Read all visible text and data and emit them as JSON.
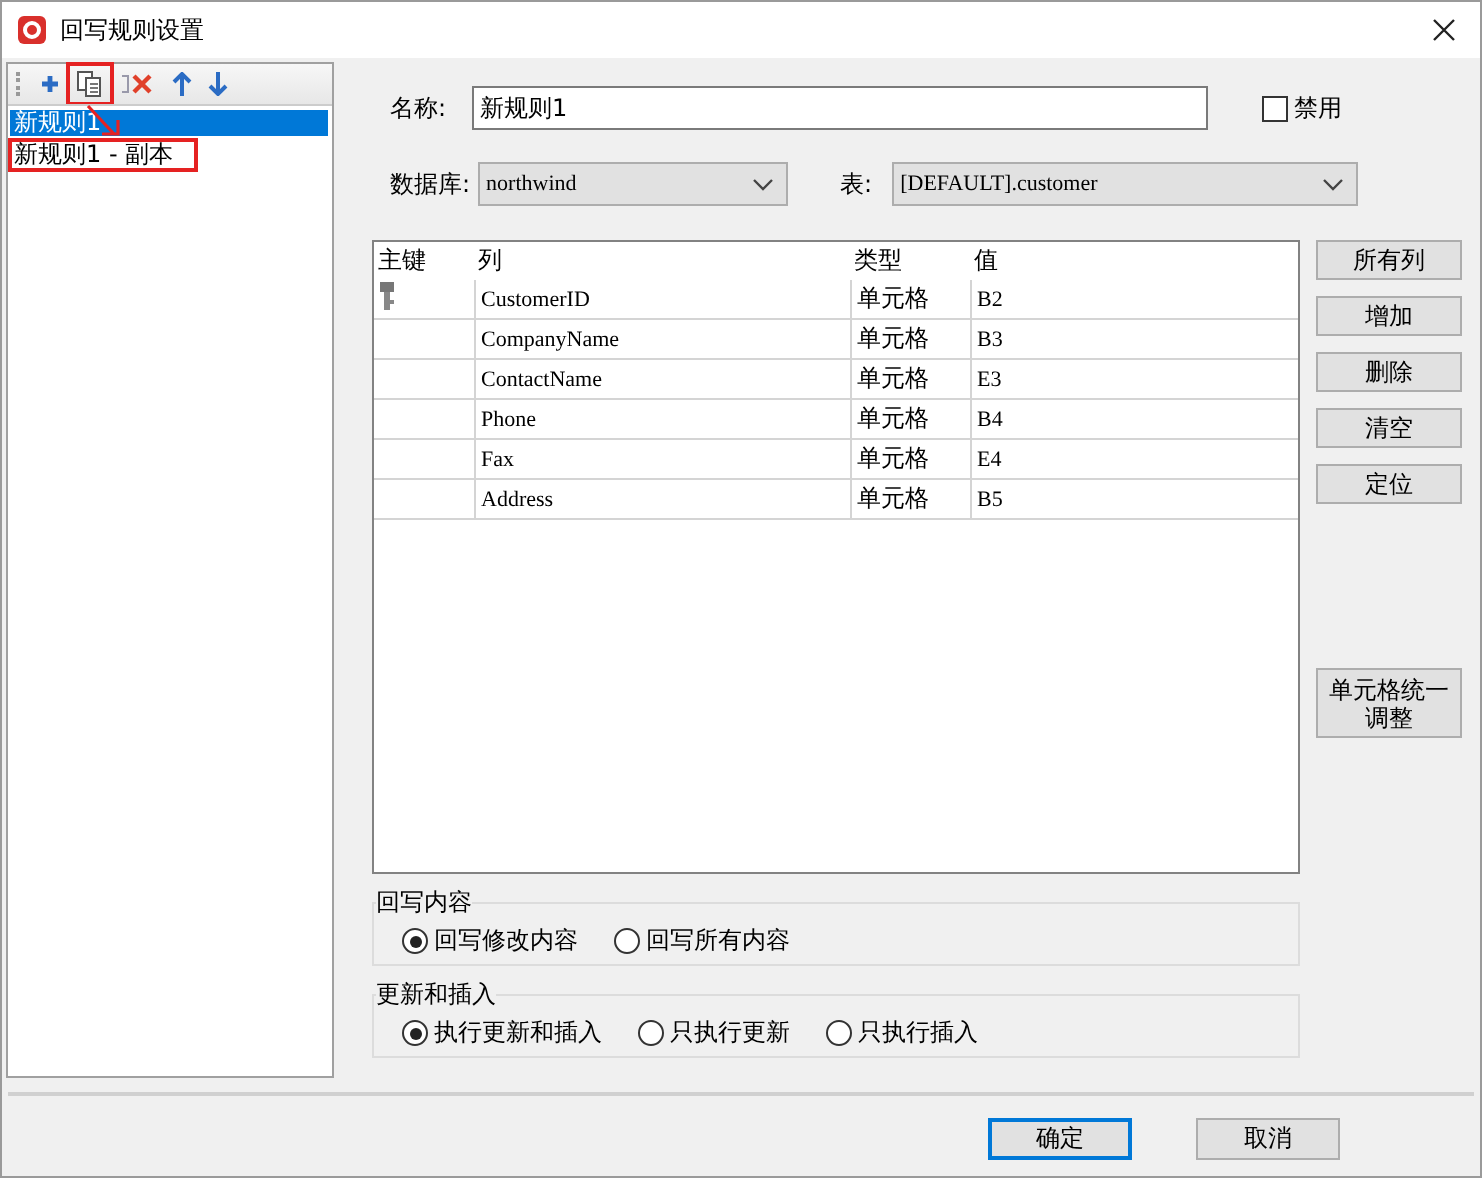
{
  "window": {
    "title": "回写规则设置"
  },
  "toolbar": [
    {
      "kind": "add",
      "annotated": false
    },
    {
      "kind": "copy",
      "annotated": true
    },
    {
      "kind": "delete",
      "annotated": false
    },
    {
      "kind": "up",
      "annotated": false
    },
    {
      "kind": "down",
      "annotated": false
    }
  ],
  "rules": [
    {
      "label": "新规则1",
      "selected": true,
      "annotated": false
    },
    {
      "label": "新规则1 - 副本",
      "selected": false,
      "annotated": true
    }
  ],
  "annotation_arrow": true,
  "name": {
    "label": "名称:",
    "value": "新规则1"
  },
  "disable": {
    "label": "禁用",
    "checked": false
  },
  "database": {
    "label": "数据库:",
    "value": "northwind"
  },
  "table_select": {
    "label": "表:",
    "value": "[DEFAULT].customer"
  },
  "grid": {
    "columns": [
      "主键",
      "列",
      "类型",
      "值"
    ],
    "rows": [
      {
        "primary_key": true,
        "column": "CustomerID",
        "type": "单元格",
        "value": "B2"
      },
      {
        "primary_key": false,
        "column": "CompanyName",
        "type": "单元格",
        "value": "B3"
      },
      {
        "primary_key": false,
        "column": "ContactName",
        "type": "单元格",
        "value": "E3"
      },
      {
        "primary_key": false,
        "column": "Phone",
        "type": "单元格",
        "value": "B4"
      },
      {
        "primary_key": false,
        "column": "Fax",
        "type": "单元格",
        "value": "E4"
      },
      {
        "primary_key": false,
        "column": "Address",
        "type": "单元格",
        "value": "B5"
      }
    ]
  },
  "side_buttons": [
    "所有列",
    "增加",
    "删除",
    "清空",
    "定位"
  ],
  "adjust_button": "单元格统一调整",
  "writeback": {
    "title": "回写内容",
    "options": [
      {
        "label": "回写修改内容",
        "selected": true
      },
      {
        "label": "回写所有内容",
        "selected": false
      }
    ]
  },
  "update_insert": {
    "title": "更新和插入",
    "options": [
      {
        "label": "执行更新和插入",
        "selected": true
      },
      {
        "label": "只执行更新",
        "selected": false
      },
      {
        "label": "只执行插入",
        "selected": false
      }
    ]
  },
  "buttons": [
    {
      "label": "确定",
      "default": true
    },
    {
      "label": "取消",
      "default": false
    }
  ]
}
